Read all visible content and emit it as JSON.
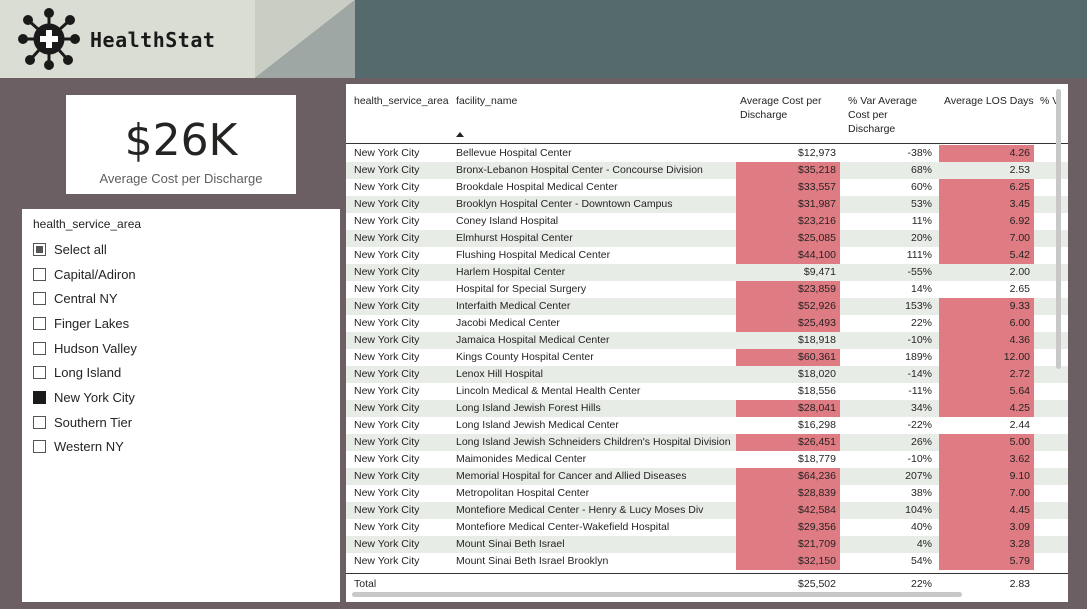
{
  "app": {
    "title": "HealthStat"
  },
  "card": {
    "value": "$26K",
    "label": "Average Cost per Discharge"
  },
  "slicer": {
    "title": "health_service_area",
    "items": [
      {
        "label": "Select all",
        "state": "partial"
      },
      {
        "label": "Capital/Adiron",
        "state": "unchecked"
      },
      {
        "label": "Central NY",
        "state": "unchecked"
      },
      {
        "label": "Finger Lakes",
        "state": "unchecked"
      },
      {
        "label": "Hudson Valley",
        "state": "unchecked"
      },
      {
        "label": "Long Island",
        "state": "unchecked"
      },
      {
        "label": "New York City",
        "state": "checked"
      },
      {
        "label": "Southern Tier",
        "state": "unchecked"
      },
      {
        "label": "Western NY",
        "state": "unchecked"
      }
    ]
  },
  "table": {
    "columns": {
      "area": "health_service_area",
      "facility": "facility_name",
      "cost": "Average Cost per Discharge",
      "var": "% Var Average Cost per Discharge",
      "los": "Average LOS Days",
      "extra": "% V"
    },
    "highlight_color": "#df7b83",
    "rows": [
      {
        "area": "New York City",
        "facility": "Bellevue Hospital Center",
        "cost": "$12,973",
        "var": "-38%",
        "los": "4.26",
        "cost_hl": false,
        "los_hl": true
      },
      {
        "area": "New York City",
        "facility": "Bronx-Lebanon Hospital Center - Concourse Division",
        "cost": "$35,218",
        "var": "68%",
        "los": "2.53",
        "cost_hl": true,
        "los_hl": false
      },
      {
        "area": "New York City",
        "facility": "Brookdale Hospital Medical Center",
        "cost": "$33,557",
        "var": "60%",
        "los": "6.25",
        "cost_hl": true,
        "los_hl": true
      },
      {
        "area": "New York City",
        "facility": "Brooklyn Hospital Center - Downtown Campus",
        "cost": "$31,987",
        "var": "53%",
        "los": "3.45",
        "cost_hl": true,
        "los_hl": true
      },
      {
        "area": "New York City",
        "facility": "Coney Island Hospital",
        "cost": "$23,216",
        "var": "11%",
        "los": "6.92",
        "cost_hl": true,
        "los_hl": true
      },
      {
        "area": "New York City",
        "facility": "Elmhurst Hospital Center",
        "cost": "$25,085",
        "var": "20%",
        "los": "7.00",
        "cost_hl": true,
        "los_hl": true
      },
      {
        "area": "New York City",
        "facility": "Flushing Hospital Medical Center",
        "cost": "$44,100",
        "var": "111%",
        "los": "5.42",
        "cost_hl": true,
        "los_hl": true
      },
      {
        "area": "New York City",
        "facility": "Harlem Hospital Center",
        "cost": "$9,471",
        "var": "-55%",
        "los": "2.00",
        "cost_hl": false,
        "los_hl": false
      },
      {
        "area": "New York City",
        "facility": "Hospital for Special Surgery",
        "cost": "$23,859",
        "var": "14%",
        "los": "2.65",
        "cost_hl": true,
        "los_hl": false
      },
      {
        "area": "New York City",
        "facility": "Interfaith Medical Center",
        "cost": "$52,926",
        "var": "153%",
        "los": "9.33",
        "cost_hl": true,
        "los_hl": true
      },
      {
        "area": "New York City",
        "facility": "Jacobi Medical Center",
        "cost": "$25,493",
        "var": "22%",
        "los": "6.00",
        "cost_hl": true,
        "los_hl": true
      },
      {
        "area": "New York City",
        "facility": "Jamaica Hospital Medical Center",
        "cost": "$18,918",
        "var": "-10%",
        "los": "4.36",
        "cost_hl": false,
        "los_hl": true
      },
      {
        "area": "New York City",
        "facility": "Kings County Hospital Center",
        "cost": "$60,361",
        "var": "189%",
        "los": "12.00",
        "cost_hl": true,
        "los_hl": true
      },
      {
        "area": "New York City",
        "facility": "Lenox Hill Hospital",
        "cost": "$18,020",
        "var": "-14%",
        "los": "2.72",
        "cost_hl": false,
        "los_hl": true
      },
      {
        "area": "New York City",
        "facility": "Lincoln Medical & Mental Health Center",
        "cost": "$18,556",
        "var": "-11%",
        "los": "5.64",
        "cost_hl": false,
        "los_hl": true
      },
      {
        "area": "New York City",
        "facility": "Long Island Jewish Forest Hills",
        "cost": "$28,041",
        "var": "34%",
        "los": "4.25",
        "cost_hl": true,
        "los_hl": true
      },
      {
        "area": "New York City",
        "facility": "Long Island Jewish Medical Center",
        "cost": "$16,298",
        "var": "-22%",
        "los": "2.44",
        "cost_hl": false,
        "los_hl": false
      },
      {
        "area": "New York City",
        "facility": "Long Island Jewish Schneiders Children's Hospital Division",
        "cost": "$26,451",
        "var": "26%",
        "los": "5.00",
        "cost_hl": true,
        "los_hl": true
      },
      {
        "area": "New York City",
        "facility": "Maimonides Medical Center",
        "cost": "$18,779",
        "var": "-10%",
        "los": "3.62",
        "cost_hl": false,
        "los_hl": true
      },
      {
        "area": "New York City",
        "facility": "Memorial Hospital for Cancer and Allied Diseases",
        "cost": "$64,236",
        "var": "207%",
        "los": "9.10",
        "cost_hl": true,
        "los_hl": true
      },
      {
        "area": "New York City",
        "facility": "Metropolitan Hospital Center",
        "cost": "$28,839",
        "var": "38%",
        "los": "7.00",
        "cost_hl": true,
        "los_hl": true
      },
      {
        "area": "New York City",
        "facility": "Montefiore Medical Center - Henry & Lucy Moses Div",
        "cost": "$42,584",
        "var": "104%",
        "los": "4.45",
        "cost_hl": true,
        "los_hl": true
      },
      {
        "area": "New York City",
        "facility": "Montefiore Medical Center-Wakefield Hospital",
        "cost": "$29,356",
        "var": "40%",
        "los": "3.09",
        "cost_hl": true,
        "los_hl": true
      },
      {
        "area": "New York City",
        "facility": "Mount Sinai Beth Israel",
        "cost": "$21,709",
        "var": "4%",
        "los": "3.28",
        "cost_hl": true,
        "los_hl": true
      },
      {
        "area": "New York City",
        "facility": "Mount Sinai Beth Israel Brooklyn",
        "cost": "$32,150",
        "var": "54%",
        "los": "5.79",
        "cost_hl": true,
        "los_hl": true
      }
    ],
    "total": {
      "label": "Total",
      "cost": "$25,502",
      "var": "22%",
      "los": "2.83"
    }
  }
}
